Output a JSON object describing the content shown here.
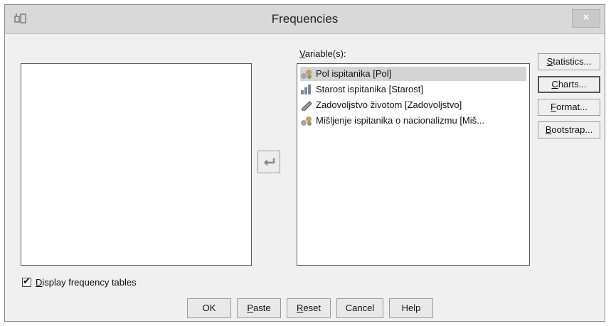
{
  "window": {
    "title": "Frequencies",
    "close_glyph": "×"
  },
  "target_list": {
    "label_first": "V",
    "label_rest": "ariable(s):",
    "items": [
      {
        "label": "Pol ispitanika [Pol]",
        "icon": "nominal-variable-icon",
        "selected": true
      },
      {
        "label": "Starost ispitanika [Starost]",
        "icon": "ordinal-variable-icon",
        "selected": false
      },
      {
        "label": "Zadovoljstvo životom [Zadovoljstvo]",
        "icon": "scale-variable-icon",
        "selected": false
      },
      {
        "label": "Mišljenje ispitanika o nacionalizmu [Miš...",
        "icon": "nominal-variable-icon",
        "selected": false
      }
    ]
  },
  "side_buttons": {
    "statistics": {
      "mnemonic": "S",
      "rest": "tatistics..."
    },
    "charts": {
      "mnemonic": "C",
      "rest": "harts..."
    },
    "format": {
      "mnemonic": "F",
      "rest": "ormat..."
    },
    "bootstrap": {
      "mnemonic": "B",
      "rest": "ootstrap..."
    }
  },
  "display_frequency": {
    "mnemonic": "D",
    "rest": "isplay frequency tables",
    "checked": true,
    "check_glyph": "✔"
  },
  "bottom_buttons": {
    "ok": "OK",
    "paste": {
      "mnemonic": "P",
      "rest": "aste"
    },
    "reset": {
      "mnemonic": "R",
      "rest": "eset"
    },
    "cancel": "Cancel",
    "help": "Help"
  },
  "colors": {
    "window_bg": "#f0f0f0",
    "titlebar_bg": "#d9d9d9",
    "selected_row": "#d4d4d4"
  }
}
